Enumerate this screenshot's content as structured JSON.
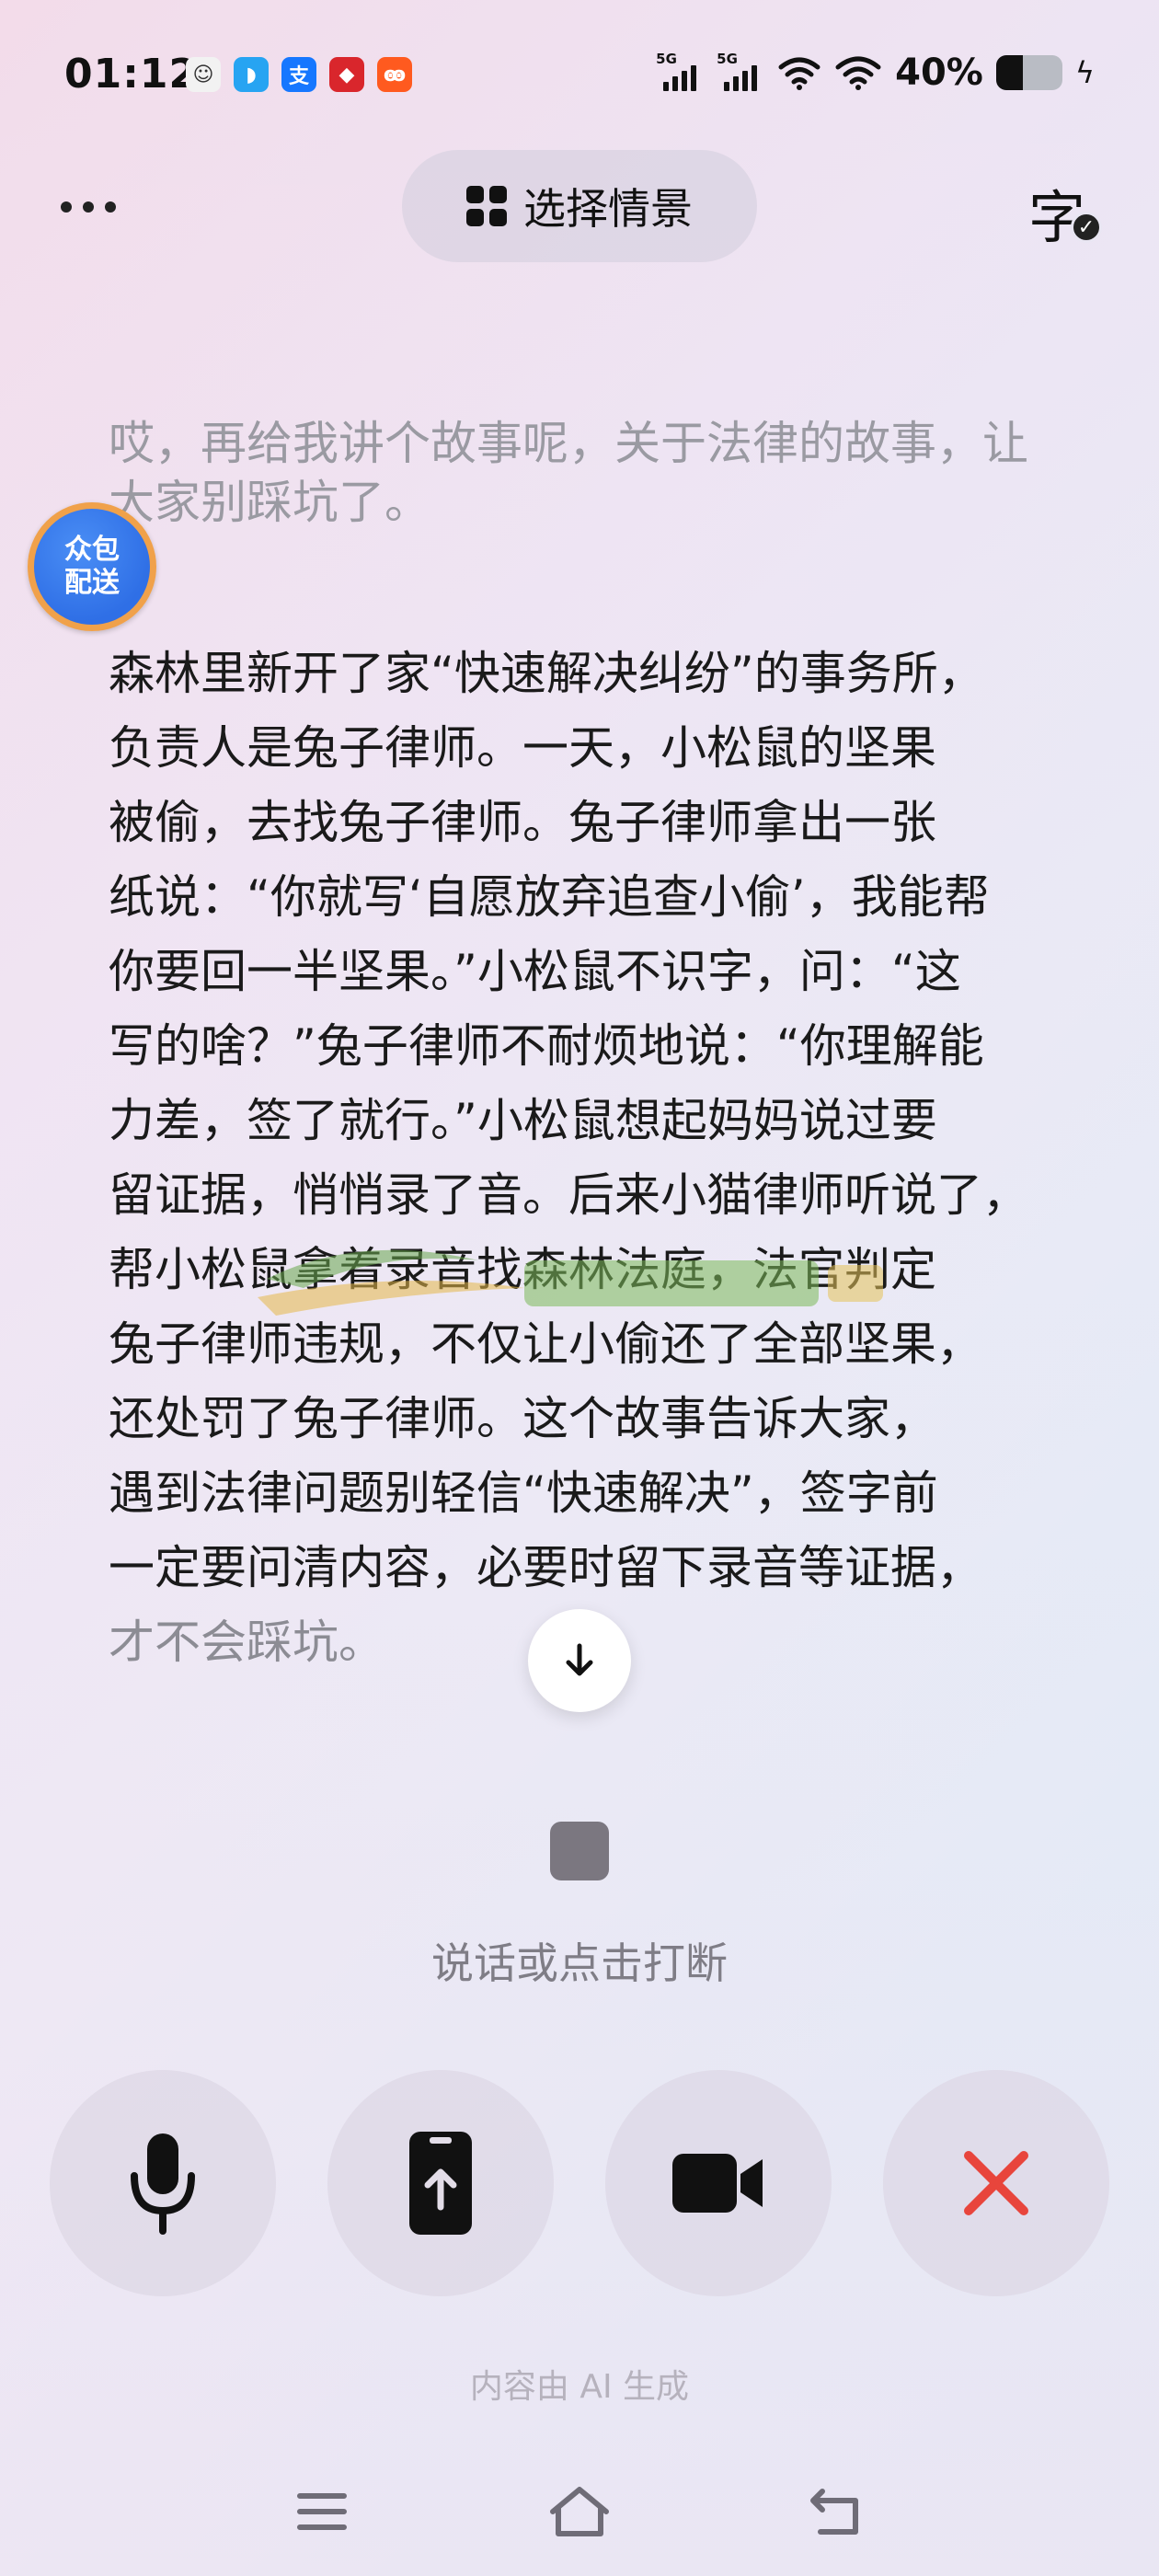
{
  "status_bar": {
    "time": "01:12",
    "app_icons": [
      {
        "name": "avatar-app-icon",
        "glyph": "☺",
        "color": "#f2f2f2",
        "fg": "#333"
      },
      {
        "name": "bird-app-icon",
        "glyph": "◗",
        "color": "#27a4f2",
        "fg": "#fff"
      },
      {
        "name": "alipay-app-icon",
        "glyph": "支",
        "color": "#1677ff",
        "fg": "#fff"
      },
      {
        "name": "news-app-icon",
        "glyph": "◆",
        "color": "#d9262c",
        "fg": "#fff"
      },
      {
        "name": "taobao-app-icon",
        "glyph": "ꙭ",
        "color": "#ff5a1f",
        "fg": "#fff"
      }
    ],
    "signal_1_label": "5G",
    "signal_2_label": "5G",
    "battery_percent_text": "40%",
    "battery_level": 0.4
  },
  "top_bar": {
    "scene_label": "选择情景",
    "caption_glyph": "字"
  },
  "conversation": {
    "user_message": "哎，再给我讲个故事呢，关于法律的故事，让大家别踩坑了。",
    "ai_lines": [
      "森林里新开了家“快速解决纠纷”的事务所，",
      "负责人是兔子律师。一天，小松鼠的坚果",
      "被偷，去找兔子律师。兔子律师拿出一张",
      "纸说：“你就写‘自愿放弃追查小偷’，我能帮",
      "你要回一半坚果。”小松鼠不识字，问：“这",
      "写的啥？”兔子律师不耐烦地说：“你理解能",
      "力差，签了就行。”小松鼠想起妈妈说过要",
      "留证据，悄悄录了音。后来小猫律师听说了，",
      "帮小松鼠拿着录音找森林法庭，法官判定",
      "兔子律师违规，不仅让小偷还了全部坚果，",
      "还处罚了兔子律师。这个故事告诉大家，",
      "遇到法律问题别轻信“快速解决”，签字前",
      "一定要问清内容，必要时留下录音等证据，",
      "才不会踩坑。"
    ]
  },
  "badge": {
    "line1": "众包",
    "line2": "配送"
  },
  "voice": {
    "hint": "说话或点击打断",
    "ai_notice": "内容由 AI 生成"
  },
  "controls": [
    {
      "name": "microphone-button",
      "icon": "microphone-icon"
    },
    {
      "name": "share-screen-button",
      "icon": "phone-upload-icon"
    },
    {
      "name": "video-button",
      "icon": "video-camera-icon"
    },
    {
      "name": "hang-up-button",
      "icon": "close-icon",
      "color": "#e8453c"
    }
  ],
  "colors": {
    "accent_red": "#e8453c",
    "badge_blue": "#2f6fe6",
    "badge_ring": "#f0a14a"
  }
}
